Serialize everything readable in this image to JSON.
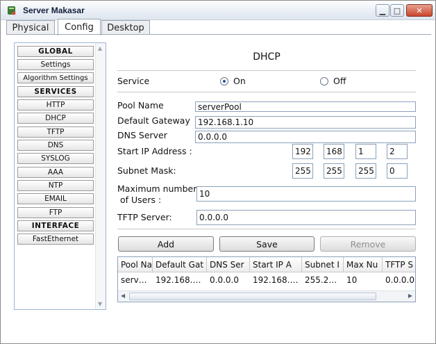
{
  "window": {
    "title": "Server Makasar",
    "buttons": {
      "minimize": "▁",
      "maximize": "□",
      "close": "✕"
    }
  },
  "tabs": [
    {
      "label": "Physical",
      "active": false
    },
    {
      "label": "Config",
      "active": true
    },
    {
      "label": "Desktop",
      "active": false
    }
  ],
  "sidebar": {
    "items": [
      {
        "label": "GLOBAL",
        "header": true
      },
      {
        "label": "Settings",
        "header": false
      },
      {
        "label": "Algorithm Settings",
        "header": false
      },
      {
        "label": "SERVICES",
        "header": true
      },
      {
        "label": "HTTP",
        "header": false
      },
      {
        "label": "DHCP",
        "header": false
      },
      {
        "label": "TFTP",
        "header": false
      },
      {
        "label": "DNS",
        "header": false
      },
      {
        "label": "SYSLOG",
        "header": false
      },
      {
        "label": "AAA",
        "header": false
      },
      {
        "label": "NTP",
        "header": false
      },
      {
        "label": "EMAIL",
        "header": false
      },
      {
        "label": "FTP",
        "header": false
      },
      {
        "label": "INTERFACE",
        "header": true
      },
      {
        "label": "FastEthernet",
        "header": false
      }
    ]
  },
  "dhcp": {
    "title": "DHCP",
    "service": {
      "label": "Service",
      "on_label": "On",
      "off_label": "Off",
      "selected": "On"
    },
    "pool_name": {
      "label": "Pool Name",
      "value": "serverPool"
    },
    "default_gateway": {
      "label": "Default Gateway",
      "value": "192.168.1.10"
    },
    "dns_server": {
      "label": "DNS Server",
      "value": "0.0.0.0"
    },
    "start_ip": {
      "label": "Start IP Address :",
      "octets": [
        "192",
        "168",
        "1",
        "2"
      ]
    },
    "subnet_mask": {
      "label": "Subnet Mask:",
      "octets": [
        "255",
        "255",
        "255",
        "0"
      ]
    },
    "max_users": {
      "label_line1": "Maximum number",
      "label_line2": "of Users :",
      "value": "10"
    },
    "tftp_server": {
      "label": "TFTP Server:",
      "value": "0.0.0.0"
    },
    "buttons": {
      "add": "Add",
      "save": "Save",
      "remove": "Remove"
    },
    "table": {
      "headers": [
        "Pool Na",
        "Default Gat",
        "DNS Ser",
        "Start IP A",
        "Subnet I",
        "Max Nu",
        "TFTP S"
      ],
      "rows": [
        [
          "serv…",
          "192.168.…",
          "0.0.0.0",
          "192.168.…",
          "255.2…",
          "10",
          "0.0.0.0"
        ]
      ]
    }
  },
  "colors": {
    "accent": "#2b4f9c",
    "border": "#8aa0ba",
    "close_button": "#c9462c"
  }
}
